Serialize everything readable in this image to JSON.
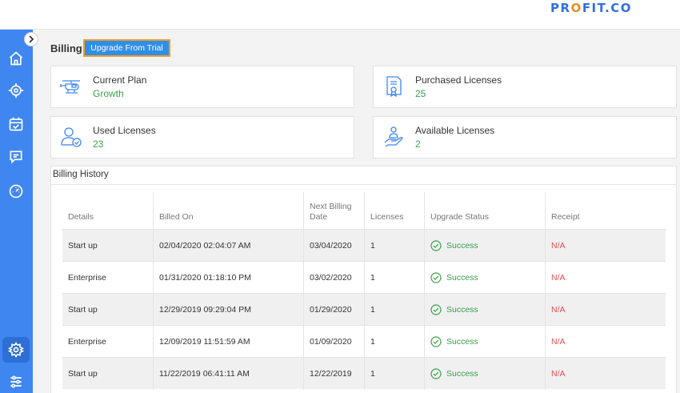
{
  "brand": {
    "logo_pre": "PR",
    "logo_o": "O",
    "logo_post": "FIT.CO"
  },
  "sidebar": {
    "items": [
      {
        "name": "home-icon"
      },
      {
        "name": "target-icon"
      },
      {
        "name": "calendar-check-icon"
      },
      {
        "name": "chat-icon"
      },
      {
        "name": "dashboard-icon"
      },
      {
        "name": "settings-icon",
        "active": true
      },
      {
        "name": "sliders-icon"
      }
    ]
  },
  "page": {
    "title": "Billing",
    "upgrade_label": "Upgrade From Trial"
  },
  "cards": {
    "current_plan": {
      "label": "Current Plan",
      "value": "Growth",
      "icon": "helicopter-icon"
    },
    "purchased": {
      "label": "Purchased Licenses",
      "value": "25",
      "icon": "certificate-icon"
    },
    "used": {
      "label": "Used Licenses",
      "value": "23",
      "icon": "user-check-icon"
    },
    "available": {
      "label": "Available Licenses",
      "value": "2",
      "icon": "hand-user-icon"
    }
  },
  "history": {
    "title": "Billing History",
    "columns": [
      "Details",
      "Billed On",
      "Next Billing Date",
      "Licenses",
      "Upgrade Status",
      "Receipt"
    ],
    "rows": [
      {
        "details": "Start up",
        "billed_on": "02/04/2020 02:04:07 AM",
        "next": "03/04/2020",
        "licenses": "1",
        "status": "Success",
        "receipt": "N/A"
      },
      {
        "details": "Enterprise",
        "billed_on": "01/31/2020 01:18:10 PM",
        "next": "03/02/2020",
        "licenses": "1",
        "status": "Success",
        "receipt": "N/A"
      },
      {
        "details": "Start up",
        "billed_on": "12/29/2019 09:29:04 PM",
        "next": "01/29/2020",
        "licenses": "1",
        "status": "Success",
        "receipt": "N/A"
      },
      {
        "details": "Enterprise",
        "billed_on": "12/09/2019 11:51:59 AM",
        "next": "01/09/2020",
        "licenses": "1",
        "status": "Success",
        "receipt": "N/A"
      },
      {
        "details": "Start up",
        "billed_on": "11/22/2019 06:41:11 AM",
        "next": "12/22/2019",
        "licenses": "1",
        "status": "Success",
        "receipt": "N/A"
      }
    ]
  },
  "colors": {
    "accent": "#3f86f0",
    "success": "#3aa04a",
    "danger": "#e05050",
    "highlight": "#f39a26"
  }
}
